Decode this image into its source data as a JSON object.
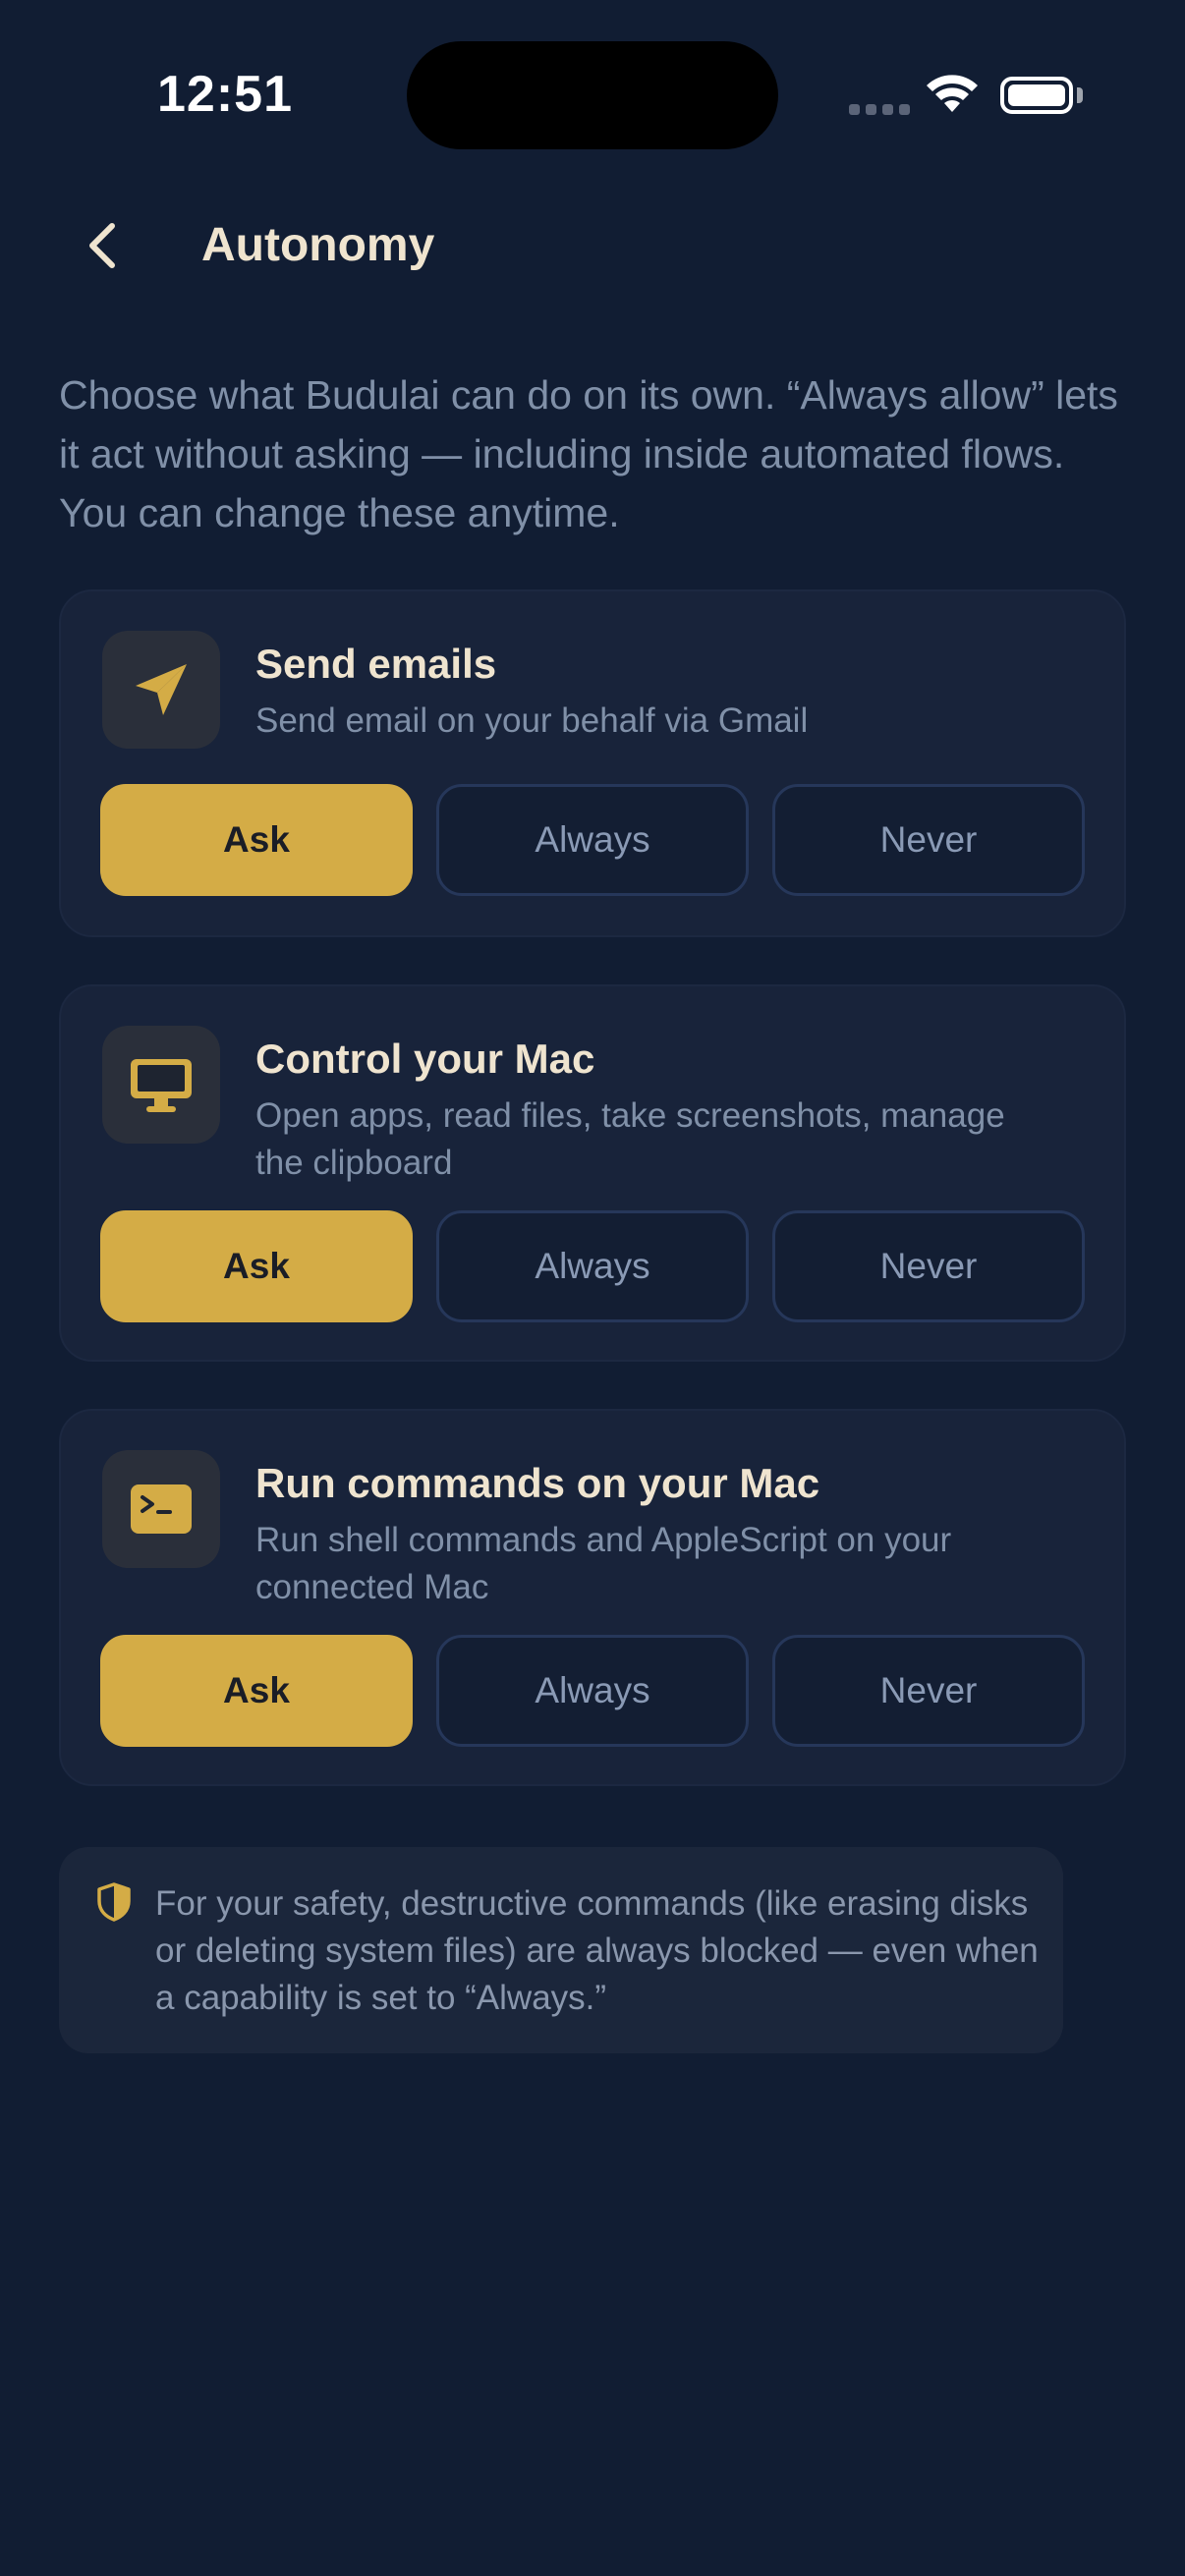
{
  "status_bar": {
    "time": "12:51"
  },
  "header": {
    "title": "Autonomy"
  },
  "intro": "Choose what Budulai can do on its own. “Always allow” lets it act without asking — including inside automated flows. You can change these anytime.",
  "options": {
    "ask": "Ask",
    "always": "Always",
    "never": "Never"
  },
  "capabilities": [
    {
      "icon": "paper-plane-icon",
      "title": "Send emails",
      "description": "Send email on your behalf via Gmail",
      "selected": "Ask"
    },
    {
      "icon": "monitor-icon",
      "title": "Control your Mac",
      "description": "Open apps, read files, take screenshots, manage the clipboard",
      "selected": "Ask"
    },
    {
      "icon": "terminal-icon",
      "title": "Run commands on your Mac",
      "description": "Run shell commands and AppleScript on your connected Mac",
      "selected": "Ask"
    }
  ],
  "safety_note": "For your safety, destructive commands (like erasing disks or deleting system files) are always blocked — even when a capability is set to “Always.”",
  "colors": {
    "background": "#111d33",
    "card": "#18233a",
    "accent": "#d4ac46",
    "title_text": "#efe4cf",
    "muted_text": "#8090a8"
  }
}
